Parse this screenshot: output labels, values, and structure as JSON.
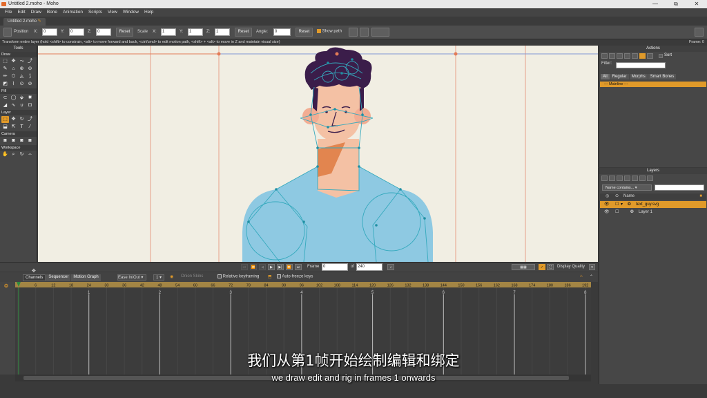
{
  "window": {
    "title": "Untitled 2.moho - Moho",
    "minimize": "—",
    "maximize": "⧉",
    "close": "✕"
  },
  "menu": [
    "File",
    "Edit",
    "Draw",
    "Bone",
    "Animation",
    "Scripts",
    "View",
    "Window",
    "Help"
  ],
  "doc_tab": "Untitled 2.moho",
  "toolbar": {
    "position_label": "Position",
    "x_label": "X:",
    "x_value": "0",
    "y_label": "Y:",
    "y_value": "0",
    "z_label": "Z:",
    "z_value": "0",
    "reset1": "Reset",
    "scale_label": "Scale",
    "sx_label": "X:",
    "sx_value": "1",
    "sy_label": "Y:",
    "sy_value": "1",
    "sz_label": "Z:",
    "sz_value": "1",
    "reset2": "Reset",
    "angle_label": "Angle:",
    "angle_value": "0",
    "reset3": "Reset",
    "show_path": "Show path"
  },
  "status": {
    "hint": "Transform entire layer (hold <shift> to constrain, <alt> to move forward and back, <ctrl/cmd> to edit motion path, <shift> + <alt> to move in Z and maintain visual size)",
    "frame": "Frame: 0"
  },
  "tools": {
    "title": "Tools",
    "sections": [
      {
        "name": "Draw",
        "icons": [
          "⬚",
          "✥",
          "⤳",
          "⤴",
          "✎",
          "⌂",
          "⊕",
          "⊖",
          "✏",
          "⬡",
          "◬",
          "⟆",
          "◩",
          "⌇",
          "⊙",
          "⊘"
        ]
      },
      {
        "name": "Fill",
        "icons": [
          "⊂",
          "◯",
          "⬙",
          "✖",
          "◢",
          "∿",
          "∪",
          "⊡"
        ]
      },
      {
        "name": "Layer",
        "icons": [
          "⬚",
          "✥",
          "↻",
          "⤴",
          "⬓",
          "⇱",
          "T",
          "⁄"
        ]
      },
      {
        "name": "Camera",
        "icons": [
          "◙",
          "◙",
          "◙",
          "◙"
        ]
      },
      {
        "name": "Workspace",
        "icons": [
          "✋",
          "⌕",
          "↻",
          "⇔"
        ]
      }
    ]
  },
  "actions": {
    "title": "Actions",
    "sort": "Sort",
    "filter_label": "Filter:",
    "tabs": [
      "All",
      "Regular",
      "Morphs",
      "Smart Bones"
    ],
    "mainline": "--- Mainline ---"
  },
  "layers": {
    "title": "Layers",
    "filter": "Name contains...",
    "header": "Name",
    "rows": [
      "text_guy.svg",
      "Layer 1"
    ]
  },
  "playback": {
    "frame_label": "Frame",
    "frame_value": "0",
    "of_label": "of",
    "total": "240",
    "quality": "Display Quality"
  },
  "timeline": {
    "tabs": [
      "Channels",
      "Sequencer",
      "Motion Graph"
    ],
    "ease": "Ease In/Out",
    "interp": "1",
    "onion": "Onion Skins",
    "relative": "Relative keyframing",
    "autofreeze": "Auto-freeze keys",
    "ruler_labels": [
      "6",
      "12",
      "18",
      "24",
      "30",
      "36",
      "42",
      "48",
      "54",
      "60",
      "66",
      "72",
      "78",
      "84",
      "90",
      "96",
      "102",
      "108",
      "114",
      "120",
      "126",
      "132",
      "138",
      "144",
      "150",
      "156",
      "162",
      "168",
      "174",
      "180",
      "186",
      "192"
    ],
    "second_labels": [
      "1",
      "2",
      "3",
      "4",
      "5",
      "6",
      "7",
      "8"
    ]
  },
  "subtitle_cn": "我们从第1帧开始绘制编辑和绑定",
  "subtitle_en": "we draw edit and rig in frames 1 onwards",
  "colors": {
    "accent": "#e09a2a",
    "canvas": "#f1eee3",
    "shirt": "#8ec9e2",
    "skin": "#f4c1a4",
    "hair": "#3b1d4a",
    "bone": "#34a9bd",
    "guide": "#e27b57"
  }
}
